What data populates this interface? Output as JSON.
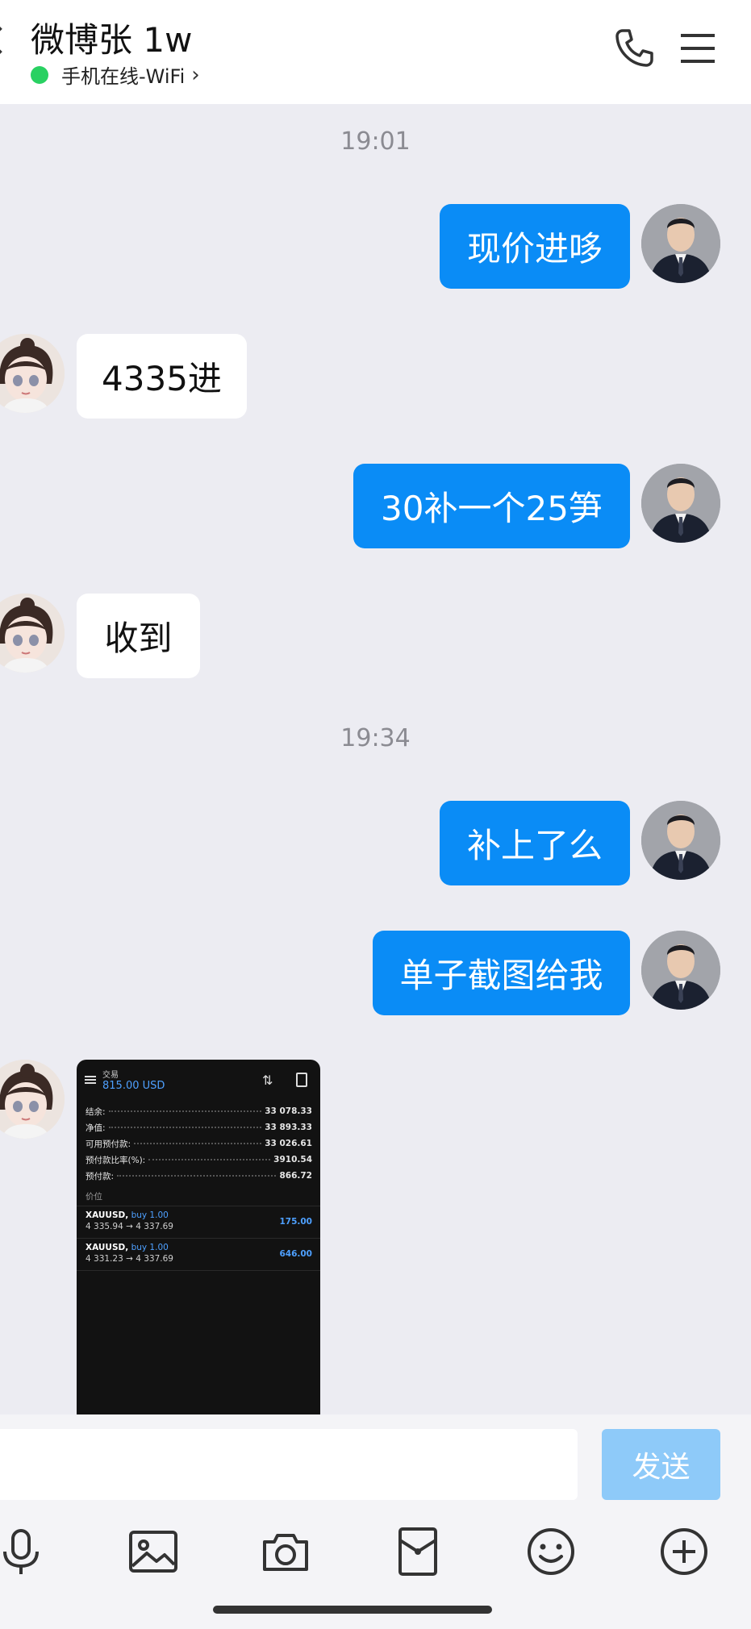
{
  "header": {
    "title": "微博张 1w",
    "status": "手机在线-WiFi",
    "status_chevron": "›",
    "status_color": "#29d162"
  },
  "timestamps": [
    "19:01",
    "19:34"
  ],
  "messages": [
    {
      "side": "out",
      "text": "现价进哆"
    },
    {
      "side": "in",
      "text": "4335进"
    },
    {
      "side": "out",
      "text": "30补一个25笋"
    },
    {
      "side": "in",
      "text": "收到"
    },
    {
      "side": "out",
      "text": "补上了么"
    },
    {
      "side": "out",
      "text": "单子截图给我"
    }
  ],
  "screenshot": {
    "subtitle": "交易",
    "balance_header": "815.00 USD",
    "rows": [
      {
        "label": "结余:",
        "value": "33 078.33"
      },
      {
        "label": "净值:",
        "value": "33 893.33"
      },
      {
        "label": "可用预付款:",
        "value": "33 026.61"
      },
      {
        "label": "预付款比率(%):",
        "value": "3910.54"
      },
      {
        "label": "预付款:",
        "value": "866.72"
      }
    ],
    "section": "价位",
    "trades": [
      {
        "symbol": "XAUUSD,",
        "dir": "buy 1.00",
        "range": "4 335.94 → 4 337.69",
        "pnl": "175.00"
      },
      {
        "symbol": "XAUUSD,",
        "dir": "buy 1.00",
        "range": "4 331.23 → 4 337.69",
        "pnl": "646.00"
      }
    ]
  },
  "composer": {
    "input_value": "",
    "send_label": "发送"
  },
  "colors": {
    "outgoing_bubble": "#0a8cf6",
    "incoming_bubble": "#ffffff",
    "background": "#ececf2",
    "send_disabled": "#8ecaf9"
  },
  "icons": [
    "back-icon",
    "phone-icon",
    "menu-icon",
    "microphone-icon",
    "image-icon",
    "camera-icon",
    "red-packet-icon",
    "emoji-icon",
    "plus-icon"
  ]
}
